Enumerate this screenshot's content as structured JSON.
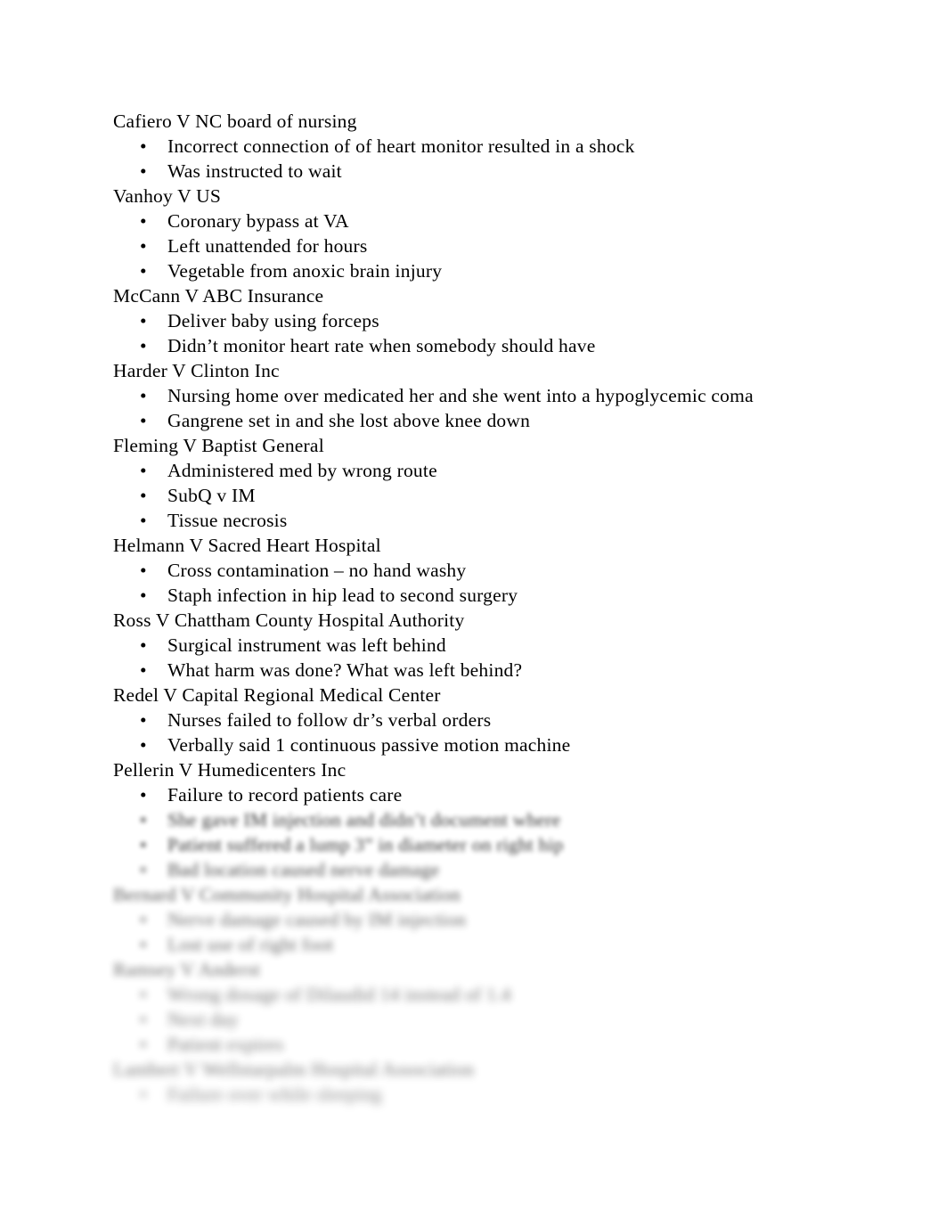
{
  "document": {
    "page_background": "#ffffff",
    "text_color": "#000000",
    "bullet_glyph": "•",
    "cases": [
      {
        "heading": "Cafiero V NC board of nursing",
        "blur": 0,
        "bullets": [
          "Incorrect connection of of heart monitor resulted in a shock",
          "Was instructed to wait"
        ]
      },
      {
        "heading": "Vanhoy V US",
        "blur": 0,
        "bullets": [
          "Coronary bypass at VA",
          "Left unattended for hours",
          "Vegetable from anoxic brain injury"
        ]
      },
      {
        "heading": "McCann V ABC Insurance",
        "blur": 0,
        "bullets": [
          "Deliver baby using forceps",
          "Didn’t monitor heart rate when somebody should have"
        ]
      },
      {
        "heading": "Harder V Clinton Inc",
        "blur": 0,
        "bullets": [
          "Nursing home over medicated her and she went into a hypoglycemic coma",
          "Gangrene set in and she lost above knee down"
        ]
      },
      {
        "heading": "Fleming V Baptist General",
        "blur": 0,
        "bullets": [
          "Administered med by wrong route",
          "SubQ v IM",
          "Tissue necrosis"
        ]
      },
      {
        "heading": "Helmann V Sacred Heart Hospital",
        "blur": 0,
        "bullets": [
          "Cross contamination – no hand washy",
          "Staph infection in hip lead to second surgery"
        ]
      },
      {
        "heading": "Ross V Chattham County Hospital Authority",
        "blur": 0,
        "bullets": [
          "Surgical instrument was left behind",
          "What harm was done? What was left behind?"
        ]
      },
      {
        "heading": "Redel V Capital Regional Medical Center",
        "blur": 0,
        "bullets": [
          "Nurses failed to follow dr’s verbal orders",
          "Verbally said 1 continuous passive motion machine"
        ]
      },
      {
        "heading": "Pellerin V Humedicenters Inc",
        "blur": 0,
        "bullets": [
          "Failure to record patients care",
          "She gave IM injection and didn’t document where",
          "Patient suffered a lump 3” in diameter on right hip",
          "Bad location caused nerve damage"
        ],
        "bullet_blur": [
          0,
          0,
          1,
          1,
          2
        ]
      },
      {
        "heading": "Bernard V Community Hospital Association",
        "blur": 2,
        "bullets": [
          "Nerve damage caused by IM injection",
          "Lost use of right foot"
        ],
        "bullet_blur": [
          3,
          3
        ]
      },
      {
        "heading": "Ramsey V Anderst",
        "blur": 3,
        "bullets": [
          "Wrong dosage of Dilaudid 14 instead of 1.4",
          "Next day",
          "Patient expires"
        ],
        "bullet_blur": [
          4,
          4,
          4
        ]
      },
      {
        "heading": "Lambert V Wellstarpalm Hospital Association",
        "blur": 4,
        "bullets": [
          "Failure over while sleeping"
        ],
        "bullet_blur": [
          5
        ]
      }
    ]
  }
}
